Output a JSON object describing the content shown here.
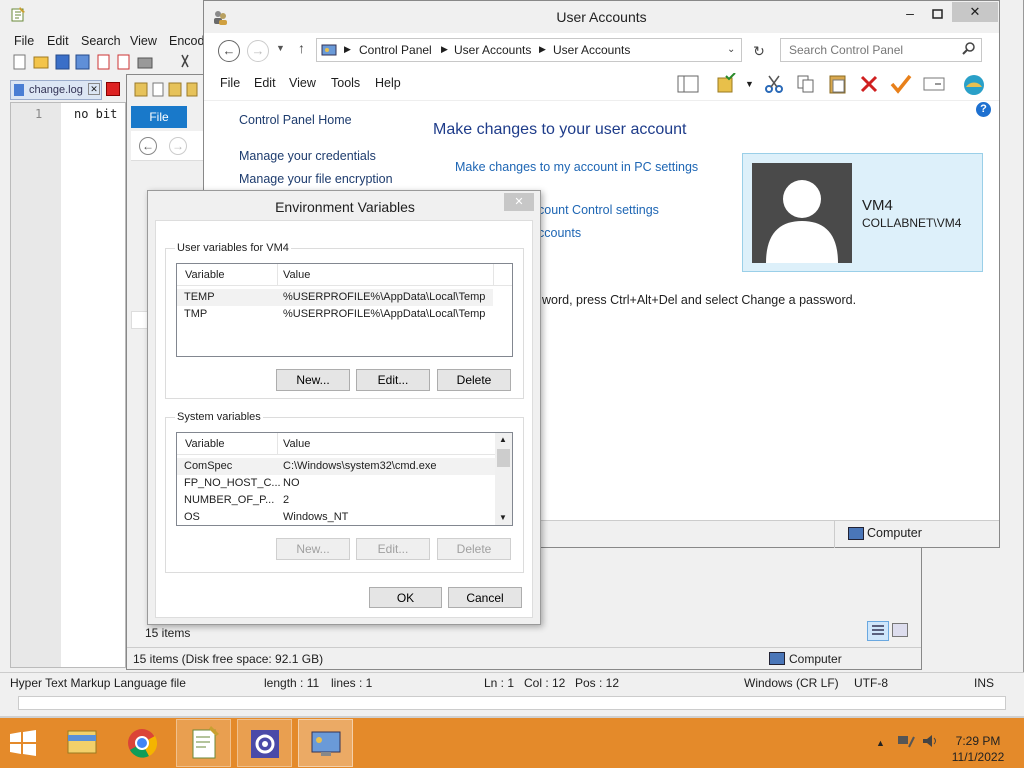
{
  "notepad": {
    "menu": [
      "File",
      "Edit",
      "Search",
      "View",
      "Encod"
    ],
    "tab_label": "change.log",
    "line_number": "1",
    "editor_text": "no bit",
    "status": {
      "file_type": "Hyper Text Markup Language file",
      "length": "length : 11",
      "lines": "lines : 1",
      "ln": "Ln : 1",
      "col": "Col : 12",
      "pos": "Pos : 12",
      "eol": "Windows (CR LF)",
      "encoding": "UTF-8",
      "mode": "INS"
    }
  },
  "explorer": {
    "file_tab": "File",
    "items_count": "15 items",
    "status_left": "15 items (Disk free space: 92.1 GB)",
    "status_right": "Computer"
  },
  "user_accounts": {
    "title": "User Accounts",
    "breadcrumb": [
      "Control Panel",
      "User Accounts",
      "User Accounts"
    ],
    "search_placeholder": "Search Control Panel",
    "menu": [
      "File",
      "Edit",
      "View",
      "Tools",
      "Help"
    ],
    "sidebar": [
      "Control Panel Home",
      "Manage your credentials",
      "Manage your file encryption"
    ],
    "heading": "Make changes to your user account",
    "links": [
      "Make changes to my account in PC settings",
      "count Control settings",
      "ccounts"
    ],
    "password_text": "word, press Ctrl+Alt+Del and select Change a password.",
    "user_name": "VM4",
    "user_domain": "COLLABNET\\VM4",
    "status_right": "Computer"
  },
  "env_dialog": {
    "title": "Environment Variables",
    "user_group": "User variables for VM4",
    "columns": [
      "Variable",
      "Value"
    ],
    "user_vars": [
      {
        "name": "TEMP",
        "value": "%USERPROFILE%\\AppData\\Local\\Temp"
      },
      {
        "name": "TMP",
        "value": "%USERPROFILE%\\AppData\\Local\\Temp"
      }
    ],
    "user_buttons": {
      "new": "New...",
      "edit": "Edit...",
      "delete": "Delete"
    },
    "system_group": "System variables",
    "system_vars": [
      {
        "name": "ComSpec",
        "value": "C:\\Windows\\system32\\cmd.exe"
      },
      {
        "name": "FP_NO_HOST_C...",
        "value": "NO"
      },
      {
        "name": "NUMBER_OF_P...",
        "value": "2"
      },
      {
        "name": "OS",
        "value": "Windows_NT"
      }
    ],
    "system_buttons": {
      "new": "New...",
      "edit": "Edit...",
      "delete": "Delete"
    },
    "ok": "OK",
    "cancel": "Cancel"
  },
  "taskbar": {
    "time": "7:29 PM",
    "date": "11/1/2022"
  }
}
